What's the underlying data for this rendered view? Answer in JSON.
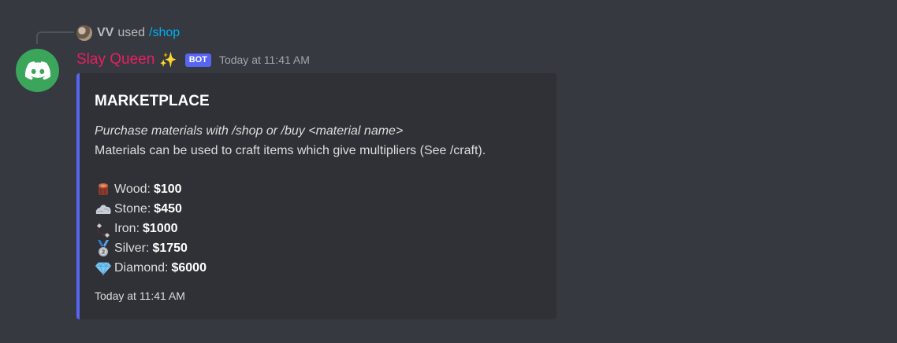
{
  "reply": {
    "user": "VV",
    "used_text": "used",
    "command": "/shop"
  },
  "message": {
    "username": "Slay Queen",
    "username_emoji": "✨",
    "bot_tag": "BOT",
    "timestamp": "Today at 11:41 AM",
    "avatar_color": "#3ba55c",
    "username_color": "#e91e63"
  },
  "embed": {
    "accent_color": "#5865f2",
    "title": "MARKETPLACE",
    "line_italic": "Purchase materials with /shop or /buy <material name>",
    "line_plain": "Materials can be used to craft items which give multipliers (See /craft).",
    "materials": [
      {
        "icon": "wood-log-icon",
        "name": "Wood:",
        "price": "$100"
      },
      {
        "icon": "stone-rock-icon",
        "name": "Stone:",
        "price": "$450"
      },
      {
        "icon": "magnet-icon",
        "name": "Iron:",
        "price": "$1000"
      },
      {
        "icon": "silver-medal-icon",
        "name": "Silver:",
        "price": "$1750"
      },
      {
        "icon": "diamond-gem-icon",
        "name": "Diamond:",
        "price": "$6000"
      }
    ],
    "footer": "Today at 11:41 AM"
  }
}
